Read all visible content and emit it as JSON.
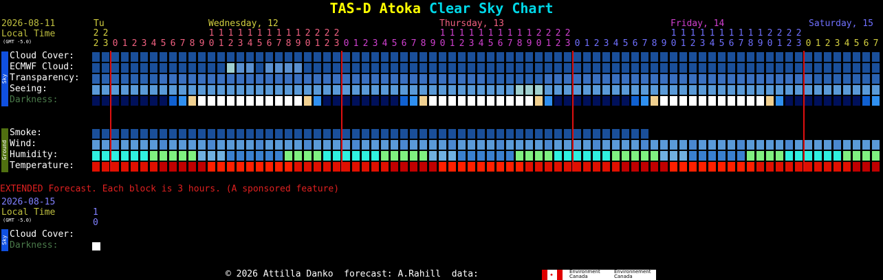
{
  "title": {
    "part1": "TAS-D Atoka",
    "part2": "Clear Sky Chart"
  },
  "colors": {
    "part1": "#ffff00",
    "part2": "#00d8e8"
  },
  "header": {
    "date": "2026-08-11",
    "local_time": "Local Time",
    "gmt": "(GMT -5.0)",
    "days": [
      {
        "label": "Tu",
        "color": "#d4d040"
      },
      {
        "label": "Wednesday, 12",
        "color": "#d4d040"
      },
      {
        "label": "Thursday, 13",
        "color": "#f06080"
      },
      {
        "label": "Friday, 14",
        "color": "#d040d0"
      },
      {
        "label": "Saturday, 15",
        "color": "#7070ff"
      }
    ]
  },
  "sky_tag": "Sky",
  "ground_tag": "Ground",
  "rows": {
    "cloud": "Cloud Cover:",
    "ecmwf": "ECMWF Cloud:",
    "transparency": "Transparency:",
    "seeing": "Seeing:",
    "darkness": "Darkness:",
    "smoke": "Smoke:",
    "wind": "Wind:",
    "humidity": "Humidity:",
    "temperature": "Temperature:"
  },
  "extended": {
    "note": "EXTENDED Forecast. Each block is 3 hours. (A sponsored feature)",
    "date": "2026-08-15",
    "local_time": "Local Time",
    "gmt": "(GMT -5.0)",
    "hour_top": "1",
    "hour_bottom": "0",
    "cloud": "Cloud Cover:",
    "darkness": "Darkness:"
  },
  "footer": {
    "copyright": "© 2026 Attilla Danko  forecast: A.Rahill  data:"
  },
  "env_canada": {
    "en1": "Environment",
    "en2": "Canada",
    "fr1": "Environnement",
    "fr2": "Canada"
  }
}
